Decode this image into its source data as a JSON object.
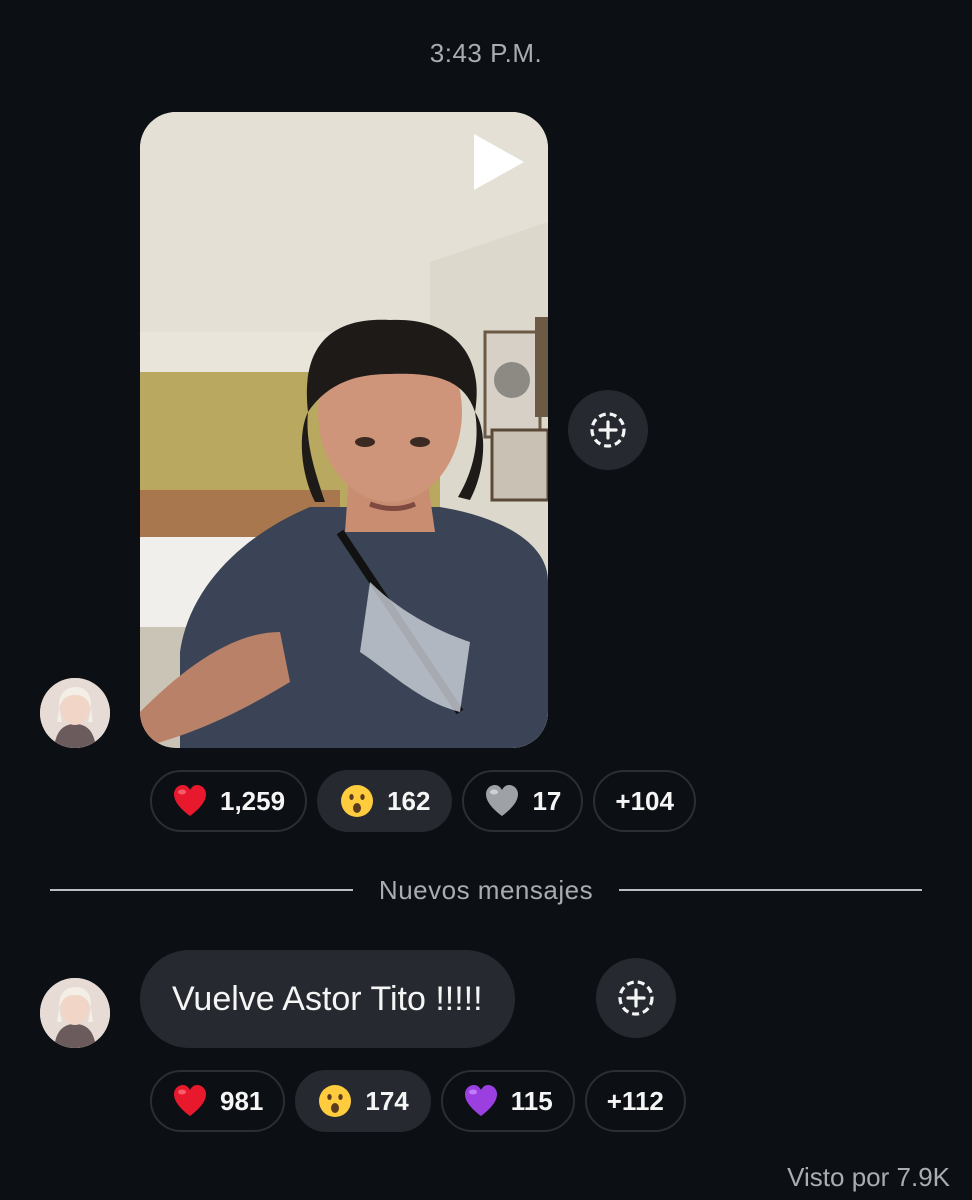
{
  "thread": {
    "timestamp": "3:43 P.M.",
    "divider_label": "Nuevos mensajes",
    "seen_by": "Visto por 7.9K"
  },
  "messages": [
    {
      "type": "video",
      "reactions": [
        {
          "emoji": "red-heart",
          "count": "1,259",
          "selected": false
        },
        {
          "emoji": "surprised-face",
          "count": "162",
          "selected": true
        },
        {
          "emoji": "grey-heart",
          "count": "17",
          "selected": false
        },
        {
          "emoji": null,
          "count": "+104",
          "selected": false
        }
      ]
    },
    {
      "type": "text",
      "text": "Vuelve Astor Tito !!!!!",
      "reactions": [
        {
          "emoji": "red-heart",
          "count": "981",
          "selected": false
        },
        {
          "emoji": "surprised-face",
          "count": "174",
          "selected": true
        },
        {
          "emoji": "purple-heart",
          "count": "115",
          "selected": false
        },
        {
          "emoji": null,
          "count": "+112",
          "selected": false
        }
      ]
    }
  ],
  "colors": {
    "background": "#0c1014",
    "bubble": "#262a30",
    "muted_text": "#a8adb3"
  }
}
